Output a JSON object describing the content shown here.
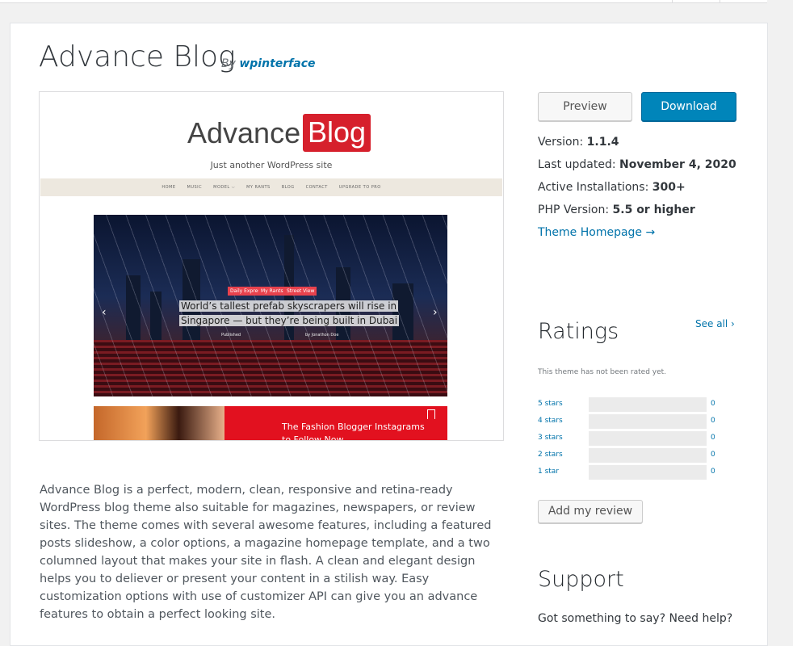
{
  "theme": {
    "title": "Advance Blog",
    "by_label": "By",
    "author": "wpinterface"
  },
  "screenshot": {
    "logo_text": "Advance",
    "logo_box": "Blog",
    "tagline": "Just another WordPress site",
    "nav": [
      "HOME",
      "MUSIC",
      "MODEL ⌵",
      "MY RANTS",
      "BLOG",
      "CONTACT",
      "UPGRADE TO PRO"
    ],
    "slide_categories": [
      "Daily Express",
      "My Rants",
      "Street View"
    ],
    "slide_caption_line1": "World’s tallest prefab skyscrapers will rise in",
    "slide_caption_line2": "Singapore — but they’re being built in Dubai",
    "slide_meta": "Published",
    "slide_author": "by Jonathon Doe",
    "fashion_title": "The Fashion Blogger Instagrams to Follow Now"
  },
  "description": "Advance Blog is a perfect, modern, clean, responsive and retina-ready WordPress blog theme also suitable for magazines, newspapers, or review sites. The theme comes with several awesome features, including a featured posts slideshow, a color options, a magazine homepage template, and a two columned layout that makes your site in flash. A clean and elegant design helps you to deliever or present your content in a stilish way. Easy customization options with use of customizer API can give you an advance features to obtain a perfect looking site.",
  "actions": {
    "preview": "Preview",
    "download": "Download"
  },
  "meta": {
    "version_label": "Version:",
    "version": "1.1.4",
    "updated_label": "Last updated:",
    "updated": "November 4, 2020",
    "installs_label": "Active Installations:",
    "installs": "300+",
    "php_label": "PHP Version:",
    "php": "5.5 or higher",
    "homepage_link": "Theme Homepage →"
  },
  "ratings": {
    "heading": "Ratings",
    "see_all": "See all",
    "see_all_icon": "chevron-right-icon",
    "no_rating": "This theme has not been rated yet.",
    "rows": [
      {
        "label": "5 stars",
        "count": "0"
      },
      {
        "label": "4 stars",
        "count": "0"
      },
      {
        "label": "3 stars",
        "count": "0"
      },
      {
        "label": "2 stars",
        "count": "0"
      },
      {
        "label": "1 star",
        "count": "0"
      }
    ],
    "add_review": "Add my review"
  },
  "support": {
    "heading": "Support",
    "question": "Got something to say? Need help?"
  },
  "colors": {
    "accent": "#0073aa",
    "download_bg": "#0085ba",
    "logo_red": "#d6202c"
  }
}
